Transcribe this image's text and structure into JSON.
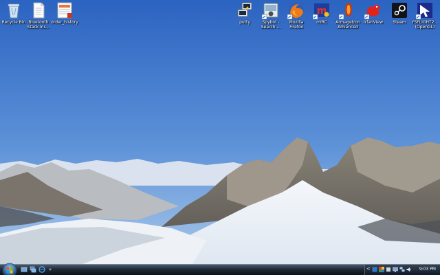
{
  "desktop": {
    "icons_left": [
      {
        "name": "recycle-bin",
        "label": "Recycle Bin"
      },
      {
        "name": "bluetooth-stack",
        "label": "Bluetooth Stack Ins..."
      },
      {
        "name": "order-history",
        "label": "order_history"
      }
    ],
    "icons_right": [
      {
        "name": "putty",
        "label": "putty"
      },
      {
        "name": "spybot",
        "label": "Spybot - Search ..."
      },
      {
        "name": "mozilla-firefox",
        "label": "Mozilla Firefox"
      },
      {
        "name": "mirc",
        "label": "mIRC"
      },
      {
        "name": "armagetron",
        "label": "Armagetron Advanced"
      },
      {
        "name": "irfanview",
        "label": "IrfanView"
      },
      {
        "name": "steam",
        "label": "Steam"
      },
      {
        "name": "ysflight",
        "label": "YSFLIGHT2... (OpenGL)"
      }
    ]
  },
  "taskbar": {
    "quick_launch_more": "»",
    "tray_expand": "<",
    "clock": "9:03 PM"
  },
  "colors": {
    "sky_top": "#2a62c0",
    "sky_bottom": "#8fb6e6",
    "taskbar": "#1f2a36"
  }
}
